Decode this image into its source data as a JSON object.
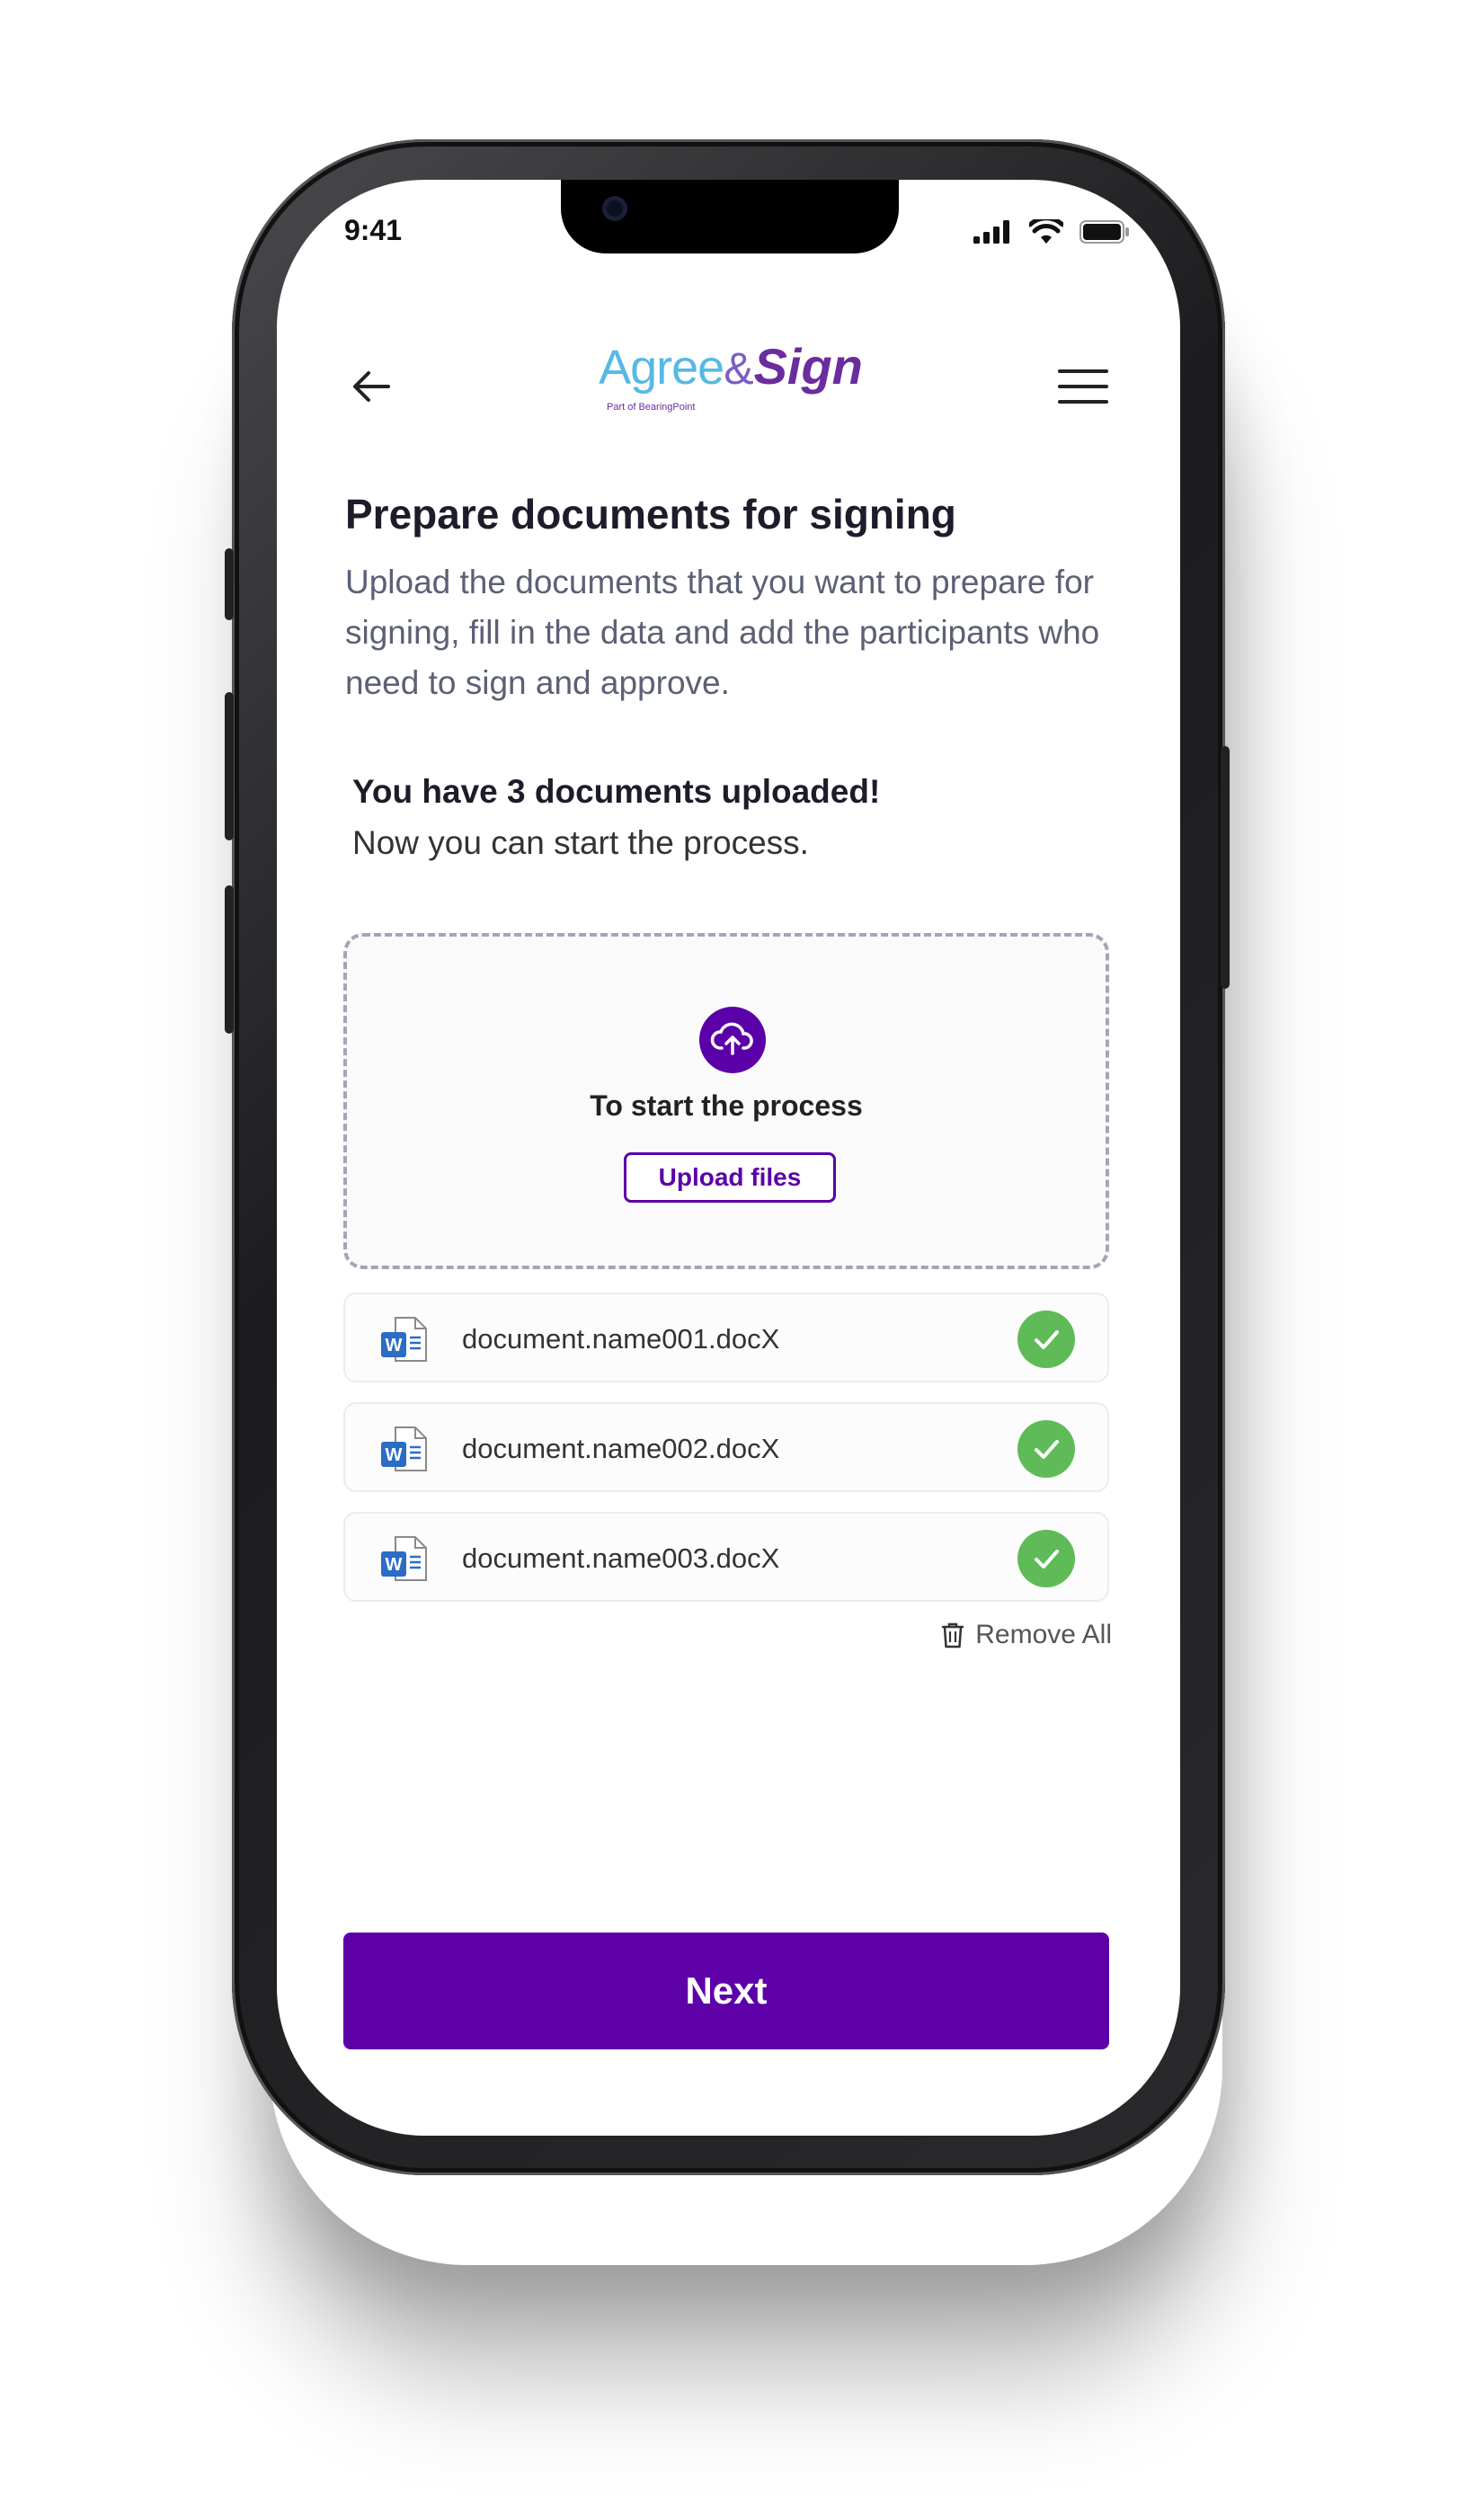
{
  "status_bar": {
    "time": "9:41"
  },
  "header": {
    "logo_agree": "Agree",
    "logo_amp": "&",
    "logo_sign": "Sign",
    "logo_sub": "Part of BearingPoint"
  },
  "page": {
    "title": "Prepare documents for signing",
    "description": "Upload the documents that you want to prepare for signing, fill in the data and add the participants who need to sign and approve.",
    "uploaded_message": "You have 3 documents uploaded!",
    "next_step_message": "Now you can start the process."
  },
  "dropzone": {
    "prompt": "To start the process",
    "upload_button": "Upload files"
  },
  "files": [
    {
      "name": "document.name001.docX",
      "status": "uploaded"
    },
    {
      "name": "document.name002.docX",
      "status": "uploaded"
    },
    {
      "name": "document.name003.docX",
      "status": "uploaded"
    }
  ],
  "remove_all_label": "Remove All",
  "next_button": "Next",
  "colors": {
    "primary": "#5e00a8",
    "success": "#5fbb58",
    "logo_blue": "#57b8e6"
  }
}
